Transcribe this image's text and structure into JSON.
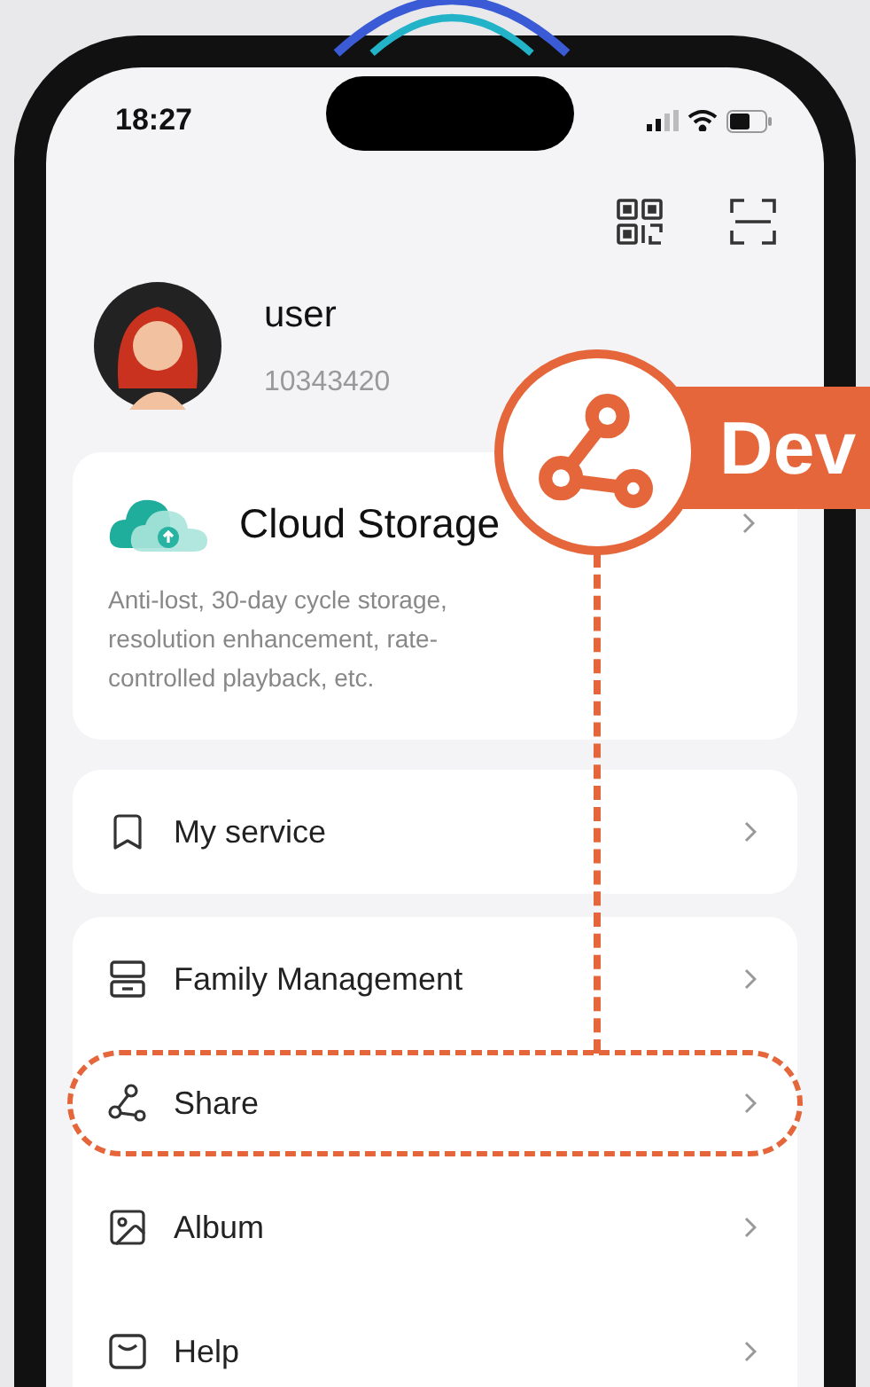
{
  "status_bar": {
    "time": "18:27"
  },
  "profile": {
    "name": "user",
    "id": "10343420"
  },
  "cloud_card": {
    "title": "Cloud Storage",
    "description": "Anti-lost, 30-day cycle storage, resolution enhancement, rate-controlled playback, etc."
  },
  "menu_groups": [
    [
      {
        "kind": "bookmark",
        "label": "My service",
        "highlighted": false
      }
    ],
    [
      {
        "kind": "family",
        "label": "Family Management",
        "highlighted": false
      },
      {
        "kind": "share",
        "label": "Share",
        "highlighted": true
      },
      {
        "kind": "album",
        "label": "Album",
        "highlighted": false
      },
      {
        "kind": "help",
        "label": "Help",
        "highlighted": false
      }
    ]
  ],
  "callout": {
    "label": "Dev"
  }
}
